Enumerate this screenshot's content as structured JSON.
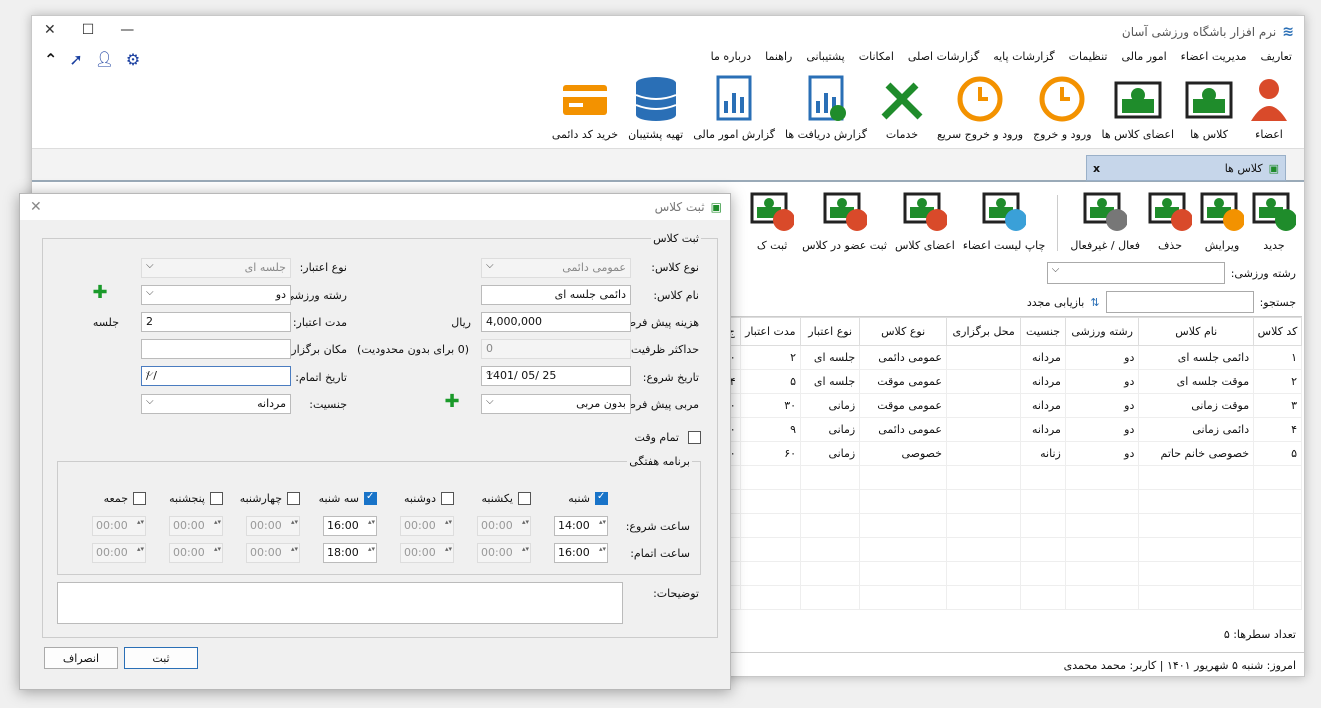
{
  "window": {
    "title": "نرم افزار باشگاه ورزشی آسان",
    "controls": [
      "✕",
      "☐",
      "—"
    ]
  },
  "menu": [
    "تعاریف",
    "مدیریت اعضاء",
    "امور مالی",
    "تنظیمات",
    "گزارشات پایه",
    "گزارشات اصلی",
    "امکانات",
    "پشتیبانی",
    "راهنما",
    "درباره ما"
  ],
  "ribbon": [
    {
      "label": "اعضاء",
      "icon": "person-icon"
    },
    {
      "label": "کلاس ها",
      "icon": "class-icon"
    },
    {
      "label": "اعضای کلاس ها",
      "icon": "class-members-icon"
    },
    {
      "label": "ورود و خروج",
      "icon": "clock-icon"
    },
    {
      "label": "ورود و خروج سریع",
      "icon": "clock-icon"
    },
    {
      "label": "خدمات",
      "icon": "tools-icon"
    },
    {
      "label": "گزارش دریافت ها",
      "icon": "report-download-icon"
    },
    {
      "label": "گزارش امور مالی",
      "icon": "report-icon"
    },
    {
      "label": "تهیه پشتیبان",
      "icon": "database-icon"
    },
    {
      "label": "خرید کد دائمی",
      "icon": "card-icon"
    }
  ],
  "doctab": {
    "label": "کلاس ها",
    "close": "x"
  },
  "toolbar": [
    "جدید",
    "ویرایش",
    "حذف",
    "فعال / غیرفعال",
    "چاپ لیست اعضاء",
    "اعضای کلاس",
    "ثبت عضو در کلاس",
    "ثبت ک"
  ],
  "filter": {
    "sport_label": "رشته ورزشی:",
    "search_label": "جستجو:",
    "refresh": "بازیابی مجدد"
  },
  "grid": {
    "headers": [
      "کد کلاس",
      "نام کلاس",
      "رشته ورزشی",
      "جنسیت",
      "محل برگزاری",
      "نوع کلاس",
      "نوع اعتبار",
      "مدت اعتبار",
      "ج"
    ],
    "rows": [
      [
        "۱",
        "دائمی جلسه ای",
        "دو",
        "مردانه",
        "",
        "عمومی دائمی",
        "جلسه ای",
        "۲",
        "۰"
      ],
      [
        "۲",
        "موقت جلسه ای",
        "دو",
        "مردانه",
        "",
        "عمومی موقت",
        "جلسه ای",
        "۵",
        "۴"
      ],
      [
        "۳",
        "موقت زمانی",
        "دو",
        "مردانه",
        "",
        "عمومی موقت",
        "زمانی",
        "۳۰",
        "۰"
      ],
      [
        "۴",
        "دائمی زمانی",
        "دو",
        "مردانه",
        "",
        "عمومی دائمی",
        "زمانی",
        "۹",
        "۰"
      ],
      [
        "۵",
        "خصوصی خانم حاتم",
        "دو",
        "زنانه",
        "",
        "خصوصی",
        "زمانی",
        "۶۰",
        "۰"
      ]
    ]
  },
  "rowcount": "تعداد سطرها:  ۵",
  "status": "امروز: شنبه ۵ شهریور ۱۴۰۱   |   کاربر: محمد محمدی",
  "dialog": {
    "title": "ثبت کلاس",
    "group": "ثبت کلاس",
    "class_type_label": "نوع کلاس:",
    "class_type": "عمومی دائمی",
    "validity_type_label": "نوع اعتبار:",
    "validity_type": "جلسه ای",
    "class_name_label": "نام کلاس:",
    "class_name": "دائمی جلسه ای",
    "sport_label": "رشته ورزشی:",
    "sport": "دو",
    "fee_label": "هزینه پیش فرض:",
    "fee": "4,000,000",
    "fee_unit": "ریال",
    "duration_label": "مدت اعتبار:",
    "duration": "2",
    "duration_unit": "جلسه",
    "capacity_label": "حداکثر ظرفیت:",
    "capacity": "0",
    "capacity_hint": "(0 برای بدون محدودیت)",
    "location_label": "مکان برگزاری:",
    "start_label": "تاریخ شروع:",
    "start": "1401/ 05/ 25",
    "end_label": "تاریخ اتمام:",
    "end": "/     /",
    "coach_label": "مربی پیش فرض:",
    "coach": "بدون مربی",
    "gender_label": "جنسیت:",
    "gender": "مردانه",
    "fulltime_label": "تمام وقت",
    "schedule_label": "برنامه هفتگی",
    "start_time_label": "ساعت شروع:",
    "end_time_label": "ساعت اتمام:",
    "days": [
      {
        "name": "شنبه",
        "on": true,
        "start": "14:00",
        "end": "16:00"
      },
      {
        "name": "یکشنبه",
        "on": false,
        "start": "00:00",
        "end": "00:00"
      },
      {
        "name": "دوشنبه",
        "on": false,
        "start": "00:00",
        "end": "00:00"
      },
      {
        "name": "سه شنبه",
        "on": true,
        "start": "16:00",
        "end": "18:00"
      },
      {
        "name": "چهارشنبه",
        "on": false,
        "start": "00:00",
        "end": "00:00"
      },
      {
        "name": "پنجشنبه",
        "on": false,
        "start": "00:00",
        "end": "00:00"
      },
      {
        "name": "جمعه",
        "on": false,
        "start": "00:00",
        "end": "00:00"
      }
    ],
    "notes_label": "توضیحات:",
    "submit": "ثبت",
    "cancel": "انصراف"
  },
  "colors": {
    "green": "#1f8c2b",
    "orange": "#f39200",
    "blue": "#2a6fb6",
    "red": "#d94a2a"
  }
}
